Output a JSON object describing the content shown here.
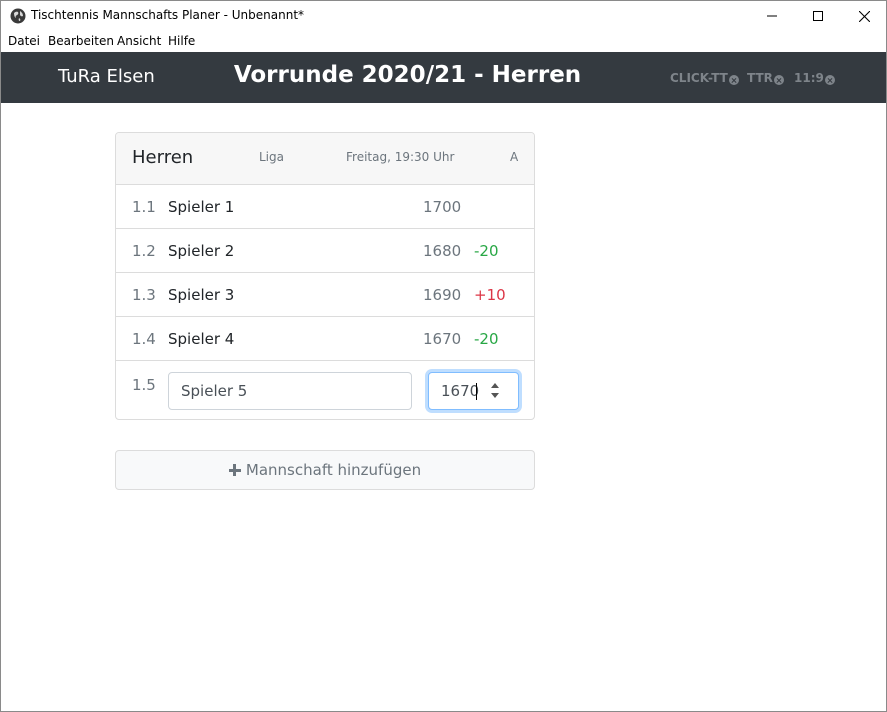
{
  "window": {
    "title": "Tischtennis Mannschafts Planer - Unbenannt*",
    "icon": "globe-icon"
  },
  "menu": [
    "Datei",
    "Bearbeiten",
    "Ansicht",
    "Hilfe"
  ],
  "header": {
    "club": "TuRa Elsen",
    "heading": "Vorrunde 2020/21 - Herren",
    "background": "#343a40",
    "nav": [
      {
        "label": "CLICK-TT",
        "icon": "close-circle-icon"
      },
      {
        "label": "TTR",
        "icon": "close-circle-icon"
      },
      {
        "label": "11:9",
        "icon": "close-circle-icon"
      }
    ]
  },
  "team": {
    "name": "Herren",
    "league": "Liga",
    "schedule": "Freitag, 19:30 Uhr",
    "week": "A",
    "players": [
      {
        "pos": "1.1",
        "name": "Spieler 1",
        "rating": "1700",
        "delta": ""
      },
      {
        "pos": "1.2",
        "name": "Spieler 2",
        "rating": "1680",
        "delta": "-20"
      },
      {
        "pos": "1.3",
        "name": "Spieler 3",
        "rating": "1690",
        "delta": "+10"
      },
      {
        "pos": "1.4",
        "name": "Spieler 4",
        "rating": "1670",
        "delta": "-20"
      }
    ],
    "edit": {
      "pos": "1.5",
      "name": "Spieler 5",
      "rating": "1670"
    }
  },
  "colors": {
    "positive": "#28a745",
    "negative": "#dc3545",
    "focus": "#80bdff"
  },
  "add_team_label": "Mannschaft hinzufügen"
}
